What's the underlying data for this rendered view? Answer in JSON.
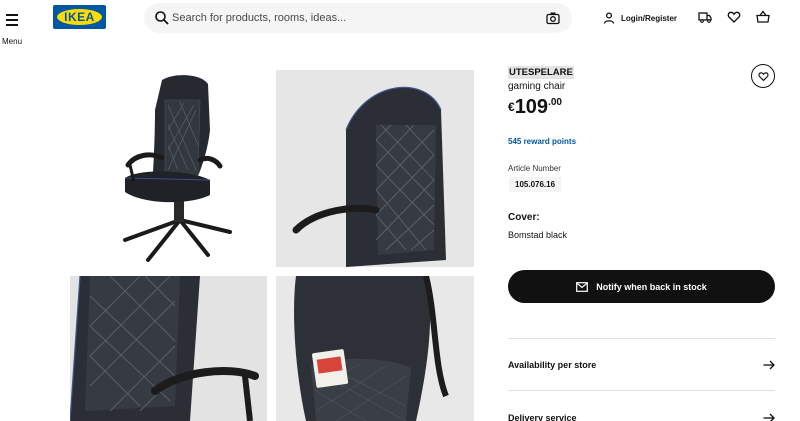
{
  "header": {
    "menu_label": "Menu",
    "logo_text": "IKEA",
    "search_placeholder": "Search for products, rooms, ideas...",
    "login_label": "Login/Register",
    "icons": [
      "menu-icon",
      "search-icon",
      "camera-icon",
      "user-icon",
      "truck-icon",
      "heart-icon",
      "basket-icon"
    ]
  },
  "product": {
    "name": "UTESPELARE",
    "type": "gaming chair",
    "price_currency": "€",
    "price_integer": "109",
    "price_decimal": ".00",
    "reward_points": "545 reward points",
    "article_label": "Article Number",
    "article_number": "105.076.16",
    "cover_title": "Cover:",
    "cover_value": "Bomstad black"
  },
  "actions": {
    "notify_label": "Notify when back in stock",
    "availability_label": "Availability per store",
    "delivery_label": "Delivery service"
  },
  "colors": {
    "brand_blue": "#0058a3",
    "brand_yellow": "#ffdb00",
    "button_dark": "#111111",
    "reward_blue": "#0058a3"
  }
}
